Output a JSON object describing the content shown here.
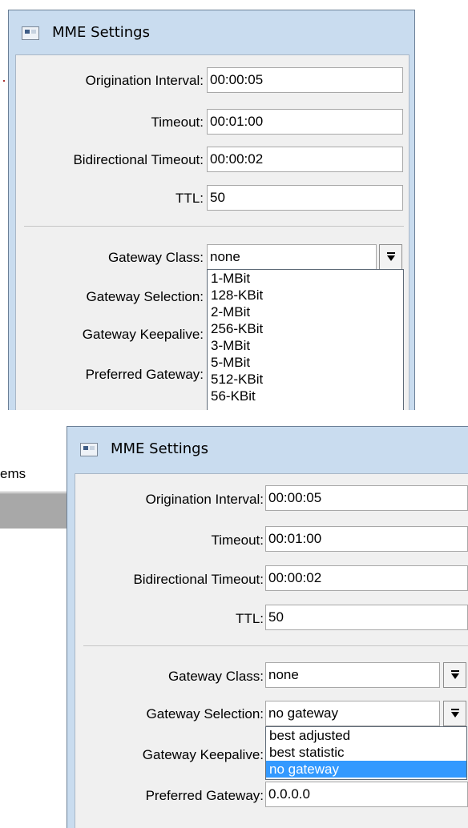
{
  "window_title": "MME Settings",
  "background": {
    "menu_fragment": "ems"
  },
  "window1": {
    "fields": [
      {
        "label": "Origination Interval:",
        "value": "00:00:05"
      },
      {
        "label": "Timeout:",
        "value": "00:01:00"
      },
      {
        "label": "Bidirectional Timeout:",
        "value": "00:00:02"
      },
      {
        "label": "TTL:",
        "value": "50"
      }
    ],
    "gateway_class": {
      "label": "Gateway Class:",
      "value": "none"
    },
    "labels": {
      "gateway_selection": "Gateway Selection:",
      "gateway_keepalive": "Gateway Keepalive:",
      "preferred_gateway": "Preferred Gateway:"
    },
    "dropdown_options": [
      "1-MBit",
      "128-KBit",
      "2-MBit",
      "256-KBit",
      "3-MBit",
      "5-MBit",
      "512-KBit",
      "56-KBit"
    ]
  },
  "window2": {
    "fields": [
      {
        "label": "Origination Interval:",
        "value": "00:00:05"
      },
      {
        "label": "Timeout:",
        "value": "00:01:00"
      },
      {
        "label": "Bidirectional Timeout:",
        "value": "00:00:02"
      },
      {
        "label": "TTL:",
        "value": "50"
      }
    ],
    "gateway_class": {
      "label": "Gateway Class:",
      "value": "none"
    },
    "gateway_selection": {
      "label": "Gateway Selection:",
      "value": "no gateway"
    },
    "labels": {
      "gateway_keepalive": "Gateway Keepalive:",
      "preferred_gateway": "Preferred Gateway:"
    },
    "preferred_gateway_value": "0.0.0.0",
    "dropdown_options": [
      "best adjusted",
      "best statistic",
      "no gateway"
    ],
    "dropdown_selected": "no gateway"
  }
}
